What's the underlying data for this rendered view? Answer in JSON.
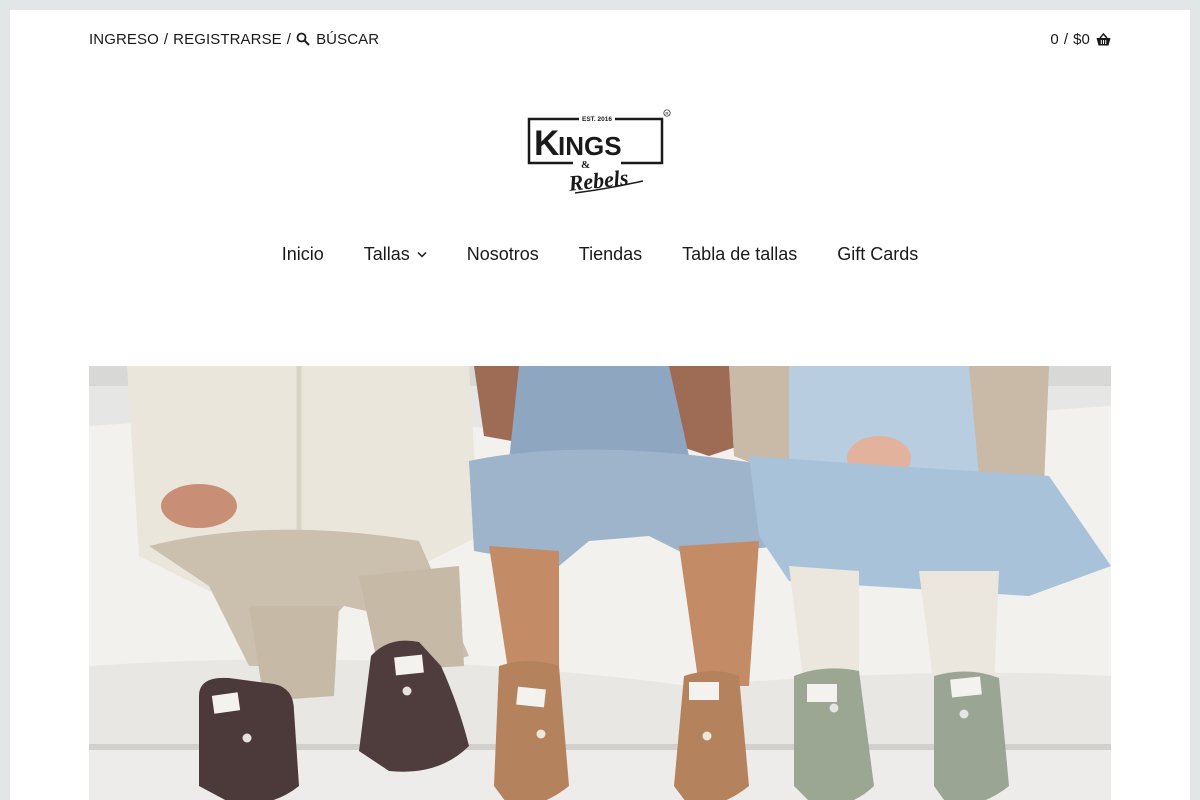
{
  "header": {
    "login_label": "INGRESO",
    "separator": "/",
    "register_label": "REGISTRARSE",
    "search_label": "BÚSCAR",
    "cart_count": "0",
    "cart_total": "$0"
  },
  "logo": {
    "est": "EST. 2016",
    "brand_top": "KINGS",
    "ampersand": "&",
    "brand_bottom": "Rebels",
    "registered": "®"
  },
  "nav": {
    "items": [
      {
        "label": "Inicio"
      },
      {
        "label": "Tallas",
        "has_dropdown": true
      },
      {
        "label": "Nosotros"
      },
      {
        "label": "Tiendas"
      },
      {
        "label": "Tabla de tallas"
      },
      {
        "label": "Gift Cards"
      }
    ]
  },
  "hero": {
    "icon": "hero-photo-babies-booties",
    "colors": {
      "background": "#d9d9d6",
      "blanket": "#f3f2ef",
      "booties": [
        "#4e3b3c",
        "#b37f5b",
        "#9fa896"
      ]
    }
  }
}
